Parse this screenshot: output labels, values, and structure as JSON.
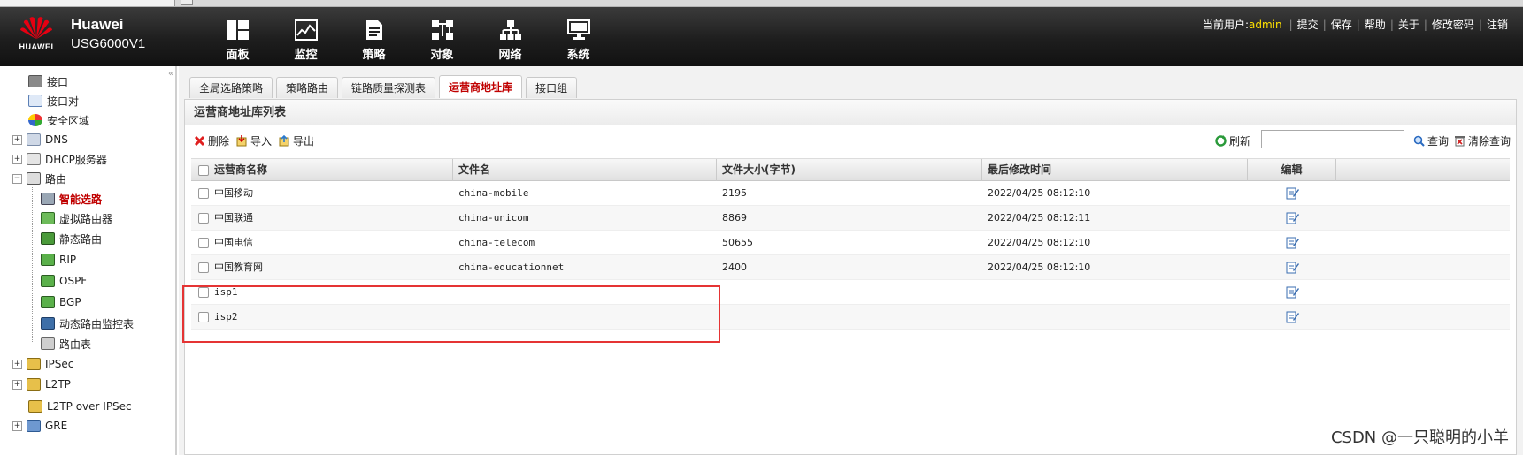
{
  "header": {
    "logo_text": "HUAWEI",
    "brand_name": "Huawei",
    "model": "USG6000V1",
    "nav": [
      {
        "label": "面板",
        "icon": "dashboard-icon"
      },
      {
        "label": "监控",
        "icon": "monitor-icon"
      },
      {
        "label": "策略",
        "icon": "policy-icon"
      },
      {
        "label": "对象",
        "icon": "object-icon"
      },
      {
        "label": "网络",
        "icon": "network-icon"
      },
      {
        "label": "系统",
        "icon": "system-icon"
      }
    ],
    "current_user_label": "当前用户:",
    "current_user": "admin",
    "links": [
      "提交",
      "保存",
      "帮助",
      "关于",
      "修改密码",
      "注销"
    ]
  },
  "sidebar": {
    "collapse": "«",
    "items": [
      {
        "label": "接口"
      },
      {
        "label": "接口对"
      },
      {
        "label": "安全区域"
      },
      {
        "label": "DNS",
        "toggle": "+"
      },
      {
        "label": "DHCP服务器",
        "toggle": "+"
      },
      {
        "label": "路由",
        "toggle": "−"
      },
      {
        "label": "智能选路"
      },
      {
        "label": "虚拟路由器"
      },
      {
        "label": "静态路由"
      },
      {
        "label": "RIP"
      },
      {
        "label": "OSPF"
      },
      {
        "label": "BGP"
      },
      {
        "label": "动态路由监控表"
      },
      {
        "label": "路由表"
      },
      {
        "label": "IPSec",
        "toggle": "+"
      },
      {
        "label": "L2TP",
        "toggle": "+"
      },
      {
        "label": "L2TP over IPSec"
      },
      {
        "label": "GRE",
        "toggle": "+"
      }
    ]
  },
  "tabs": [
    "全局选路策略",
    "策略路由",
    "链路质量探测表",
    "运营商地址库",
    "接口组"
  ],
  "panel": {
    "title": "运营商地址库列表",
    "toolbar": {
      "delete": "删除",
      "import": "导入",
      "export": "导出",
      "refresh": "刷新",
      "search_value": "",
      "query": "查询",
      "clear_query": "清除查询"
    },
    "columns": [
      "运营商名称",
      "文件名",
      "文件大小(字节)",
      "最后修改时间",
      "编辑"
    ],
    "rows": [
      {
        "name": "中国移动",
        "file": "china-mobile",
        "size": "2195",
        "modified": "2022/04/25 08:12:10"
      },
      {
        "name": "中国联通",
        "file": "china-unicom",
        "size": "8869",
        "modified": "2022/04/25 08:12:11"
      },
      {
        "name": "中国电信",
        "file": "china-telecom",
        "size": "50655",
        "modified": "2022/04/25 08:12:10"
      },
      {
        "name": "中国教育网",
        "file": "china-educationnet",
        "size": "2400",
        "modified": "2022/04/25 08:12:10"
      },
      {
        "name": "isp1",
        "file": "",
        "size": "",
        "modified": ""
      },
      {
        "name": "isp2",
        "file": "",
        "size": "",
        "modified": ""
      }
    ]
  },
  "watermark": "CSDN @一只聪明的小羊",
  "colors": {
    "accent": "#c00000",
    "user": "#ffe100",
    "highlight": "#e53434"
  }
}
